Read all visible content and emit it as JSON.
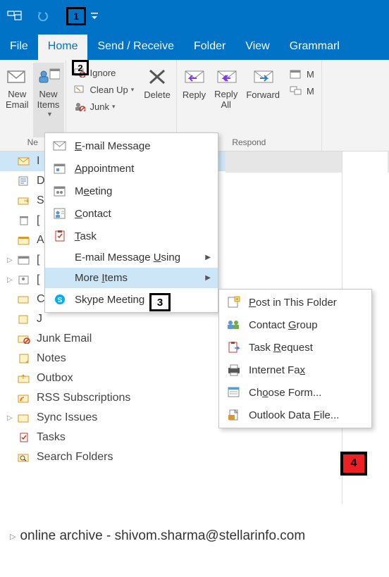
{
  "titlebar": {},
  "tabs": {
    "file": "File",
    "home": "Home",
    "sendreceive": "Send / Receive",
    "folder": "Folder",
    "view": "View",
    "grammarly": "Grammarl"
  },
  "ribbon": {
    "new": {
      "group_label": "Ne",
      "new_email": "New\nEmail",
      "new_items": "New\nItems"
    },
    "delete": {
      "ignore": "Ignore",
      "clean_up": "Clean Up",
      "junk": "Junk",
      "delete": "Delete"
    },
    "respond": {
      "group_label": "Respond",
      "reply": "Reply",
      "reply_all": "Reply\nAll",
      "forward": "Forward"
    }
  },
  "callouts": {
    "c1": "1",
    "c2": "2",
    "c3": "3",
    "c4": "4"
  },
  "menu_new_items": {
    "email_message": "E-mail Message",
    "appointment": "Appointment",
    "meeting": "Meeting",
    "contact": "Contact",
    "task": "Task",
    "email_message_using": "E-mail Message Using",
    "more_items": "More Items",
    "skype_meeting": "Skype Meeting"
  },
  "menu_more_items": {
    "post_in_folder": "Post in This Folder",
    "contact_group": "Contact Group",
    "task_request": "Task Request",
    "internet_fax": "Internet Fax",
    "choose_form": "Choose Form...",
    "outlook_data_file": "Outlook Data File..."
  },
  "folders": {
    "inbox_initial": "I",
    "drafts_initial": "D",
    "sent_initial": "S",
    "deleted_initial": "[",
    "archive_initial": "A",
    "calendar_initial": "[",
    "contacts_initial": "[",
    "conv_initial": "C",
    "journal_initial": "J",
    "junk_email": "Junk Email",
    "notes": "Notes",
    "outbox": "Outbox",
    "rss": "RSS Subscriptions",
    "sync_issues": "Sync Issues",
    "tasks": "Tasks",
    "search_folders": "Search Folders"
  },
  "archive_account": "online archive - shivom.sharma@stellarinfo.com"
}
